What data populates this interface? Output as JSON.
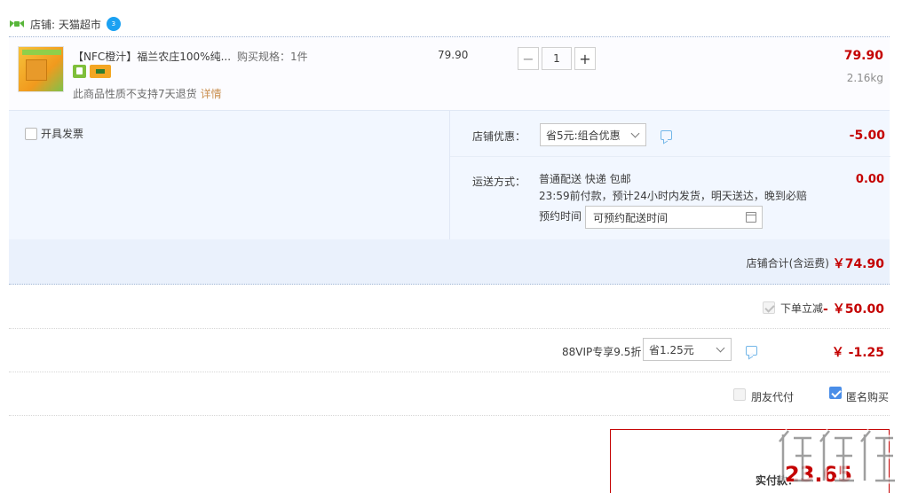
{
  "shop": {
    "name": "店铺: 天猫超市",
    "badge": "3"
  },
  "item": {
    "title": "【NFC橙汁】福兰农庄100%纯...",
    "spec": "购买规格：1件",
    "note": "此商品性质不支持7天退货",
    "note_link": "详情",
    "unit_price": "79.90",
    "quantity": "1",
    "total": "79.90",
    "weight": "2.16kg",
    "qty_minus": "−",
    "qty_plus": "+"
  },
  "invoice": {
    "label": "开具发票"
  },
  "promo": {
    "label": "店铺优惠：",
    "selected": "省5元:组合优惠",
    "amount": "-5.00"
  },
  "shipping": {
    "label": "运送方式：",
    "line1": "普通配送 快递 包邮",
    "line2": "23:59前付款，预计24小时内发货，明天送达，晚到必赔",
    "reserve_label": "预约时间",
    "reserve_placeholder": "可预约配送时间",
    "amount": "0.00"
  },
  "subtotal": {
    "label": "店铺合计(含运费)",
    "value": "￥74.90"
  },
  "order_discount": {
    "label": "下单立减",
    "value": "- ￥50.00"
  },
  "vip": {
    "label": "88VIP专享9.5折",
    "selected": "省1.25元",
    "value": "￥ -1.25"
  },
  "options": {
    "friend_pay": "朋友代付",
    "anonymous": "匿名购买"
  },
  "payment": {
    "label": "实付款：",
    "value": "23.65"
  },
  "colors": {
    "accent_red": "#c40000",
    "panel_blue": "#f2f7ff",
    "check_blue": "#4a8ee8"
  }
}
